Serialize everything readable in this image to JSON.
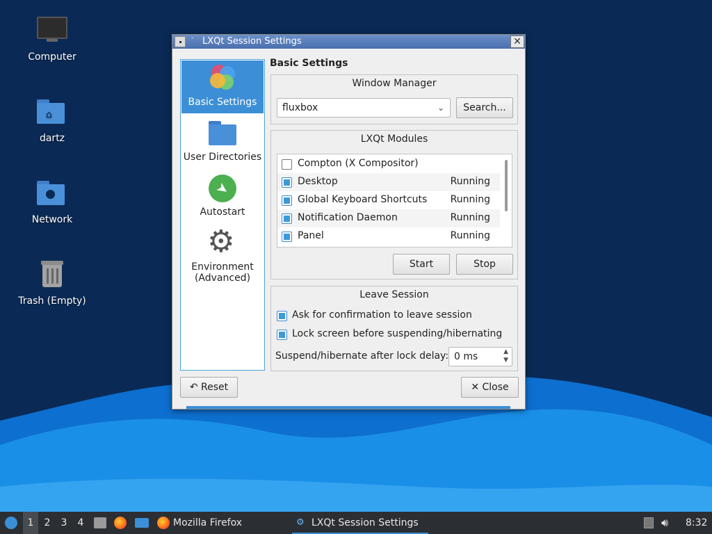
{
  "desktop": {
    "icons": [
      {
        "label": "Computer",
        "icon": "monitor-icon"
      },
      {
        "label": "dartz",
        "icon": "home-folder-icon"
      },
      {
        "label": "Network",
        "icon": "network-folder-icon"
      },
      {
        "label": "Trash (Empty)",
        "icon": "trash-icon"
      }
    ]
  },
  "window": {
    "title": "LXQt Session Settings",
    "sidebar": [
      {
        "label": "Basic Settings",
        "icon": "basic-settings-icon",
        "active": true
      },
      {
        "label": "User Directories",
        "icon": "folder-icon"
      },
      {
        "label": "Autostart",
        "icon": "rocket-icon"
      },
      {
        "label": "Environment (Advanced)",
        "label_line1": "Environment",
        "label_line2": "(Advanced)",
        "icon": "gear-icon"
      }
    ],
    "section_title": "Basic Settings",
    "window_manager": {
      "title": "Window Manager",
      "value": "fluxbox",
      "search_label": "Search..."
    },
    "modules": {
      "title": "LXQt Modules",
      "items": [
        {
          "name": "Compton (X Compositor)",
          "checked": false,
          "status": ""
        },
        {
          "name": "Desktop",
          "checked": true,
          "status": "Running"
        },
        {
          "name": "Global Keyboard Shortcuts",
          "checked": true,
          "status": "Running"
        },
        {
          "name": "Notification Daemon",
          "checked": true,
          "status": "Running"
        },
        {
          "name": "Panel",
          "checked": true,
          "status": "Running"
        }
      ],
      "start_label": "Start",
      "stop_label": "Stop"
    },
    "leave_session": {
      "title": "Leave Session",
      "confirm_label": "Ask for confirmation to leave session",
      "confirm_checked": true,
      "lock_label": "Lock screen before suspending/hibernating",
      "lock_checked": true,
      "delay_label": "Suspend/hibernate after lock delay:",
      "delay_value": "0 ms"
    },
    "reset_label": "Reset",
    "close_label": "Close"
  },
  "taskbar": {
    "desktops": [
      "1",
      "2",
      "3",
      "4"
    ],
    "current_desktop": "1",
    "tasks": [
      {
        "label": "Mozilla Firefox",
        "icon": "firefox-icon"
      },
      {
        "label": "LXQt Session Settings",
        "icon": "lxqt-icon",
        "active": true
      }
    ],
    "clock": "8:32"
  },
  "colors": {
    "accent": "#3c8fd6",
    "desktop_bg": "#0a2a55",
    "wave": "#1a8fe8"
  }
}
